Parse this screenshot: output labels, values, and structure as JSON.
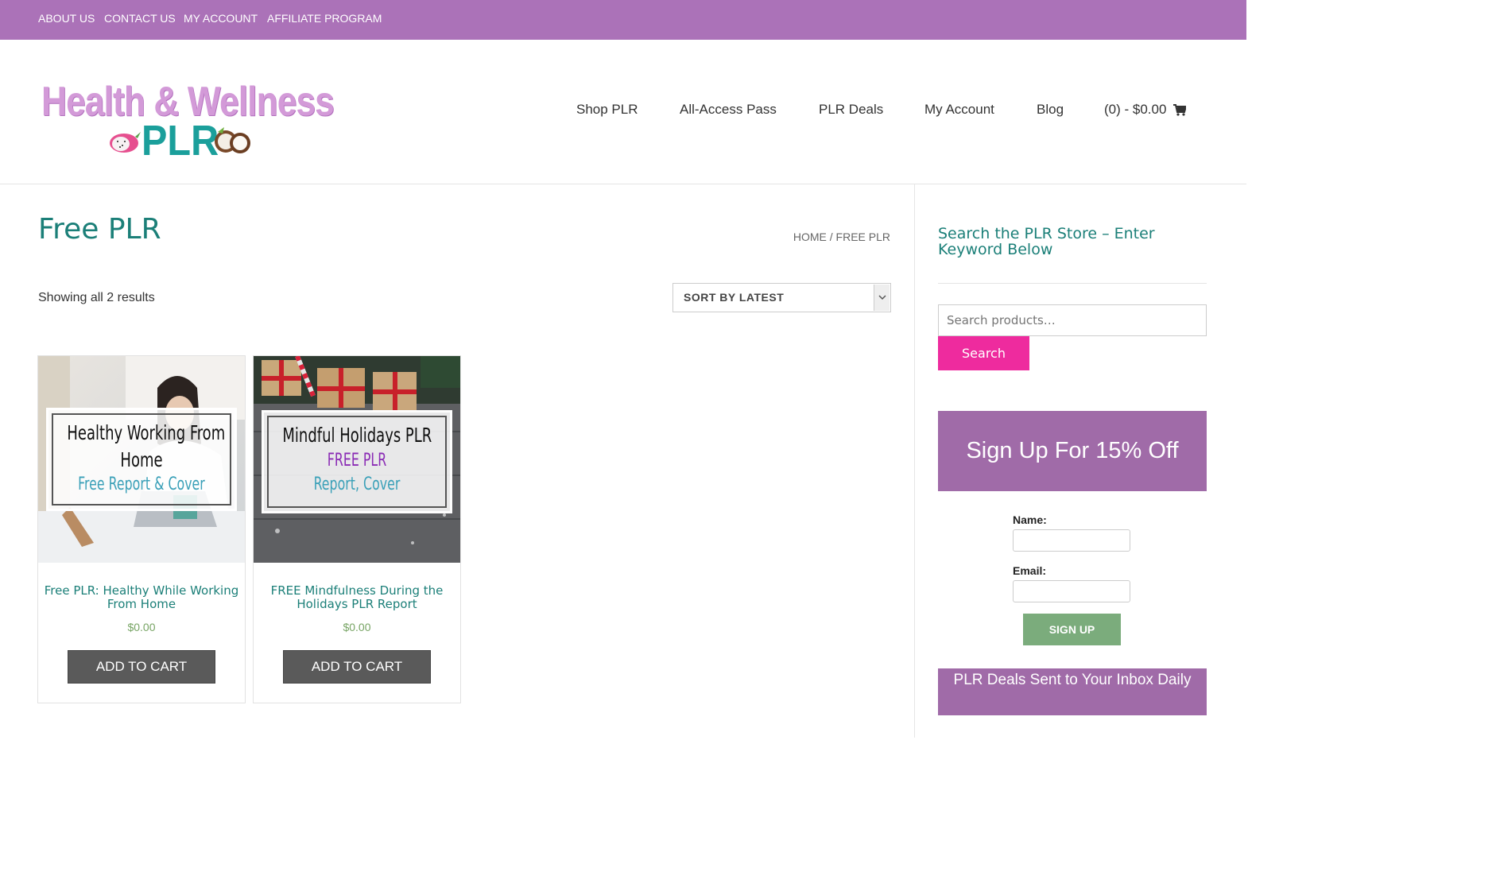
{
  "topbar": {
    "links": [
      "ABOUT US",
      "CONTACT US",
      "MY ACCOUNT",
      "AFFILIATE PROGRAM"
    ]
  },
  "logo": {
    "line1": "Health & Wellness",
    "line2": "PLR"
  },
  "nav": {
    "items": [
      "Shop PLR",
      "All-Access Pass",
      "PLR Deals",
      "My Account",
      "Blog"
    ],
    "cart": "(0) - $0.00"
  },
  "page": {
    "title": "Free PLR",
    "breadcrumb": "HOME / FREE PLR",
    "result_count": "Showing all 2 results",
    "sort_label": "SORT BY LATEST"
  },
  "products": [
    {
      "overlay_title": "Healthy Working From",
      "overlay_title2": "Home",
      "overlay_sub": "Free Report & Cover",
      "title": "Free PLR: Healthy While Working From Home",
      "price": "$0.00",
      "button": "ADD TO CART"
    },
    {
      "overlay_title": "Mindful Holidays PLR",
      "overlay_title2": "FREE PLR",
      "overlay_sub": "Report, Cover",
      "title": "FREE Mindfulness During the Holidays PLR Report",
      "price": "$0.00",
      "button": "ADD TO CART"
    }
  ],
  "sidebar": {
    "search_title": "Search the PLR Store – Enter Keyword Below",
    "search_placeholder": "Search products…",
    "search_button": "Search",
    "signup_banner": "Sign Up For 15% Off",
    "name_label": "Name:",
    "email_label": "Email:",
    "signup_button": "SIGN UP",
    "deals_banner": "PLR Deals Sent to Your Inbox Daily"
  },
  "colors": {
    "topbar": "#ab72b8",
    "accent_teal": "#1b7f78",
    "search_button": "#ee2b9e",
    "banner_purple": "#a06ba8",
    "signup_green": "#7bac7c",
    "price_green": "#77a464"
  },
  "icons": [
    "cart-icon",
    "chevron-down-icon"
  ]
}
